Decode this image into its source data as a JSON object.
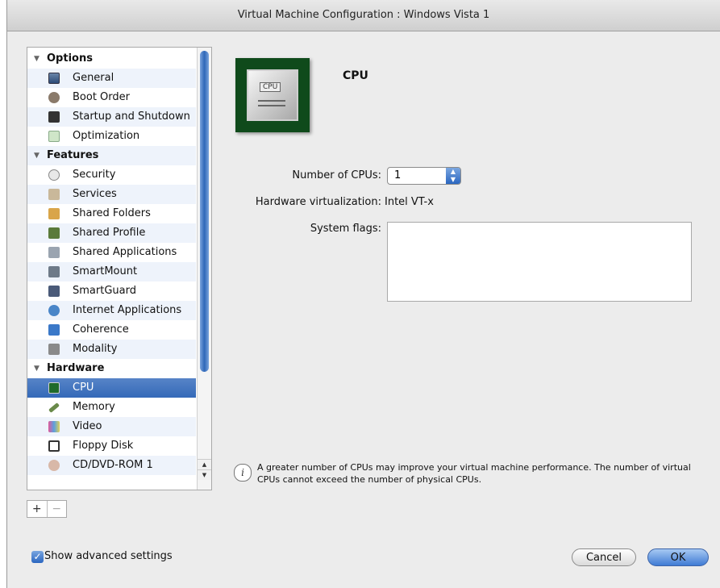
{
  "window": {
    "title": "Virtual Machine Configuration : Windows Vista 1"
  },
  "sidebar": {
    "groups": {
      "options": "Options",
      "features": "Features",
      "hardware": "Hardware"
    },
    "items": {
      "general": "General",
      "boot_order": "Boot Order",
      "startup_shutdown": "Startup and Shutdown",
      "optimization": "Optimization",
      "security": "Security",
      "services": "Services",
      "shared_folders": "Shared Folders",
      "shared_profile": "Shared Profile",
      "shared_applications": "Shared Applications",
      "smartmount": "SmartMount",
      "smartguard": "SmartGuard",
      "internet_applications": "Internet Applications",
      "coherence": "Coherence",
      "modality": "Modality",
      "cpu": "CPU",
      "memory": "Memory",
      "video": "Video",
      "floppy_disk": "Floppy Disk",
      "cd_dvd_rom": "CD/DVD-ROM 1"
    },
    "selected_item": "CPU",
    "add_label": "+",
    "remove_label": "−"
  },
  "main": {
    "heading": "CPU",
    "image_label": "CPU",
    "cpu_count_label": "Number of CPUs:",
    "cpu_count_value": "1",
    "virtualization_label": "Hardware virtualization:",
    "virtualization_value": "Intel VT-x",
    "system_flags_label": "System flags:",
    "system_flags_value": "",
    "info_text": "A greater number of CPUs may improve your virtual machine performance. The number of virtual CPUs cannot exceed the number of physical CPUs."
  },
  "footer": {
    "show_advanced_label": "Show advanced settings",
    "show_advanced_checked": true,
    "cancel_label": "Cancel",
    "ok_label": "OK"
  },
  "colors": {
    "selection": "#3a6cbb",
    "ok_button": "#5a90dc",
    "cpu_board": "#0f4a1b"
  }
}
